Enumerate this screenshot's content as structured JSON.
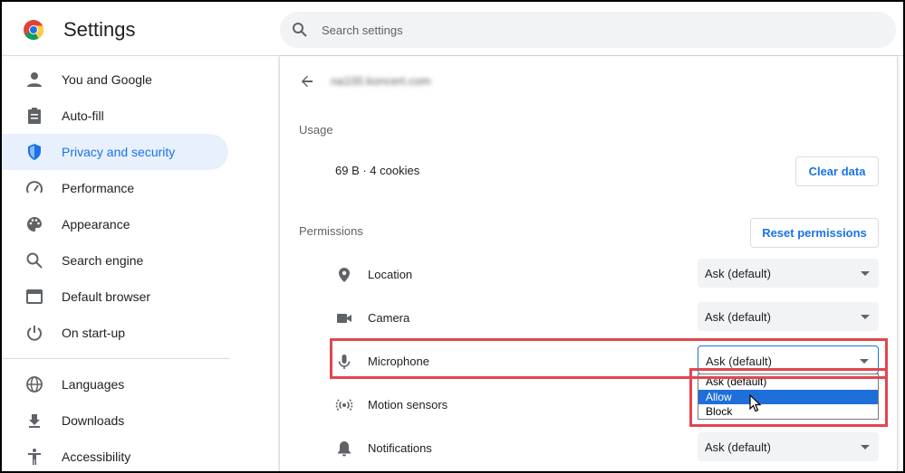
{
  "app": {
    "title": "Settings"
  },
  "search": {
    "placeholder": "Search settings"
  },
  "sidebar": {
    "items": [
      {
        "label": "You and Google",
        "icon": "person-icon"
      },
      {
        "label": "Auto-fill",
        "icon": "clipboard-icon"
      },
      {
        "label": "Privacy and security",
        "icon": "shield-icon",
        "active": true
      },
      {
        "label": "Performance",
        "icon": "speedometer-icon"
      },
      {
        "label": "Appearance",
        "icon": "palette-icon"
      },
      {
        "label": "Search engine",
        "icon": "search-icon"
      },
      {
        "label": "Default browser",
        "icon": "browser-window-icon"
      },
      {
        "label": "On start-up",
        "icon": "power-icon"
      },
      {
        "label": "Languages",
        "icon": "globe-icon"
      },
      {
        "label": "Downloads",
        "icon": "download-icon"
      },
      {
        "label": "Accessibility",
        "icon": "accessibility-icon"
      }
    ]
  },
  "main": {
    "site": "na100.koncert.com",
    "usage": {
      "heading": "Usage",
      "text": "69 B · 4 cookies",
      "clear_label": "Clear data"
    },
    "permissions": {
      "heading": "Permissions",
      "reset_label": "Reset permissions",
      "rows": [
        {
          "label": "Location",
          "icon": "location-pin-icon",
          "value": "Ask (default)"
        },
        {
          "label": "Camera",
          "icon": "camera-icon",
          "value": "Ask (default)"
        },
        {
          "label": "Microphone",
          "icon": "microphone-icon",
          "value": "Ask (default)"
        },
        {
          "label": "Motion sensors",
          "icon": "motion-sensors-icon",
          "value": ""
        },
        {
          "label": "Notifications",
          "icon": "bell-icon",
          "value": "Ask (default)"
        }
      ],
      "microphone_options": [
        "Ask (default)",
        "Allow",
        "Block"
      ],
      "highlighted_option": "Allow"
    }
  },
  "colors": {
    "accent": "#1a73e8",
    "highlight": "#e0474e",
    "active_bg": "#e8f0fe"
  }
}
